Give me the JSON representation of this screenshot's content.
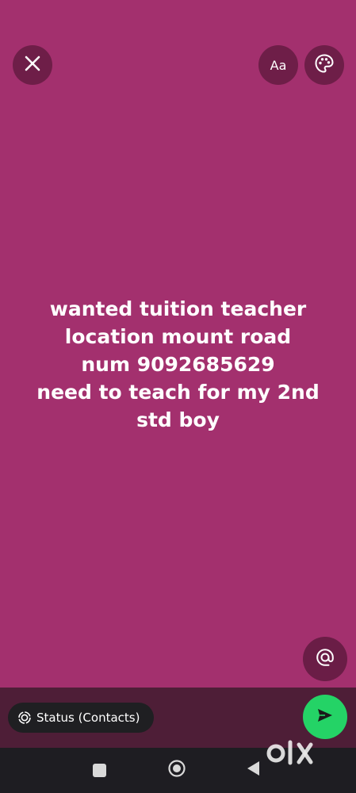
{
  "top_bar": {
    "close_icon": "close-icon",
    "font_button_label": "Aa",
    "palette_icon": "palette-icon"
  },
  "status_text": {
    "lines": [
      "wanted tuition teacher",
      "location mount road",
      "num 9092685629",
      "need to teach for my 2nd",
      "std boy"
    ]
  },
  "mention_button": {
    "icon": "at-sign-icon"
  },
  "bottom_bar": {
    "audience_label": "Status (Contacts)",
    "audience_icon": "status-ring-icon",
    "send_icon": "send-icon"
  },
  "nav": {
    "recents_icon": "square-icon",
    "home_icon": "circle-home-icon",
    "back_icon": "triangle-back-icon"
  },
  "watermark": {
    "text": "OLX"
  },
  "colors": {
    "background": "#a3306e",
    "button_bg": "#6e1e48",
    "bottom_bar": "#4e1e37",
    "send_green": "#24d366",
    "nav_bar": "#1e1d22"
  }
}
